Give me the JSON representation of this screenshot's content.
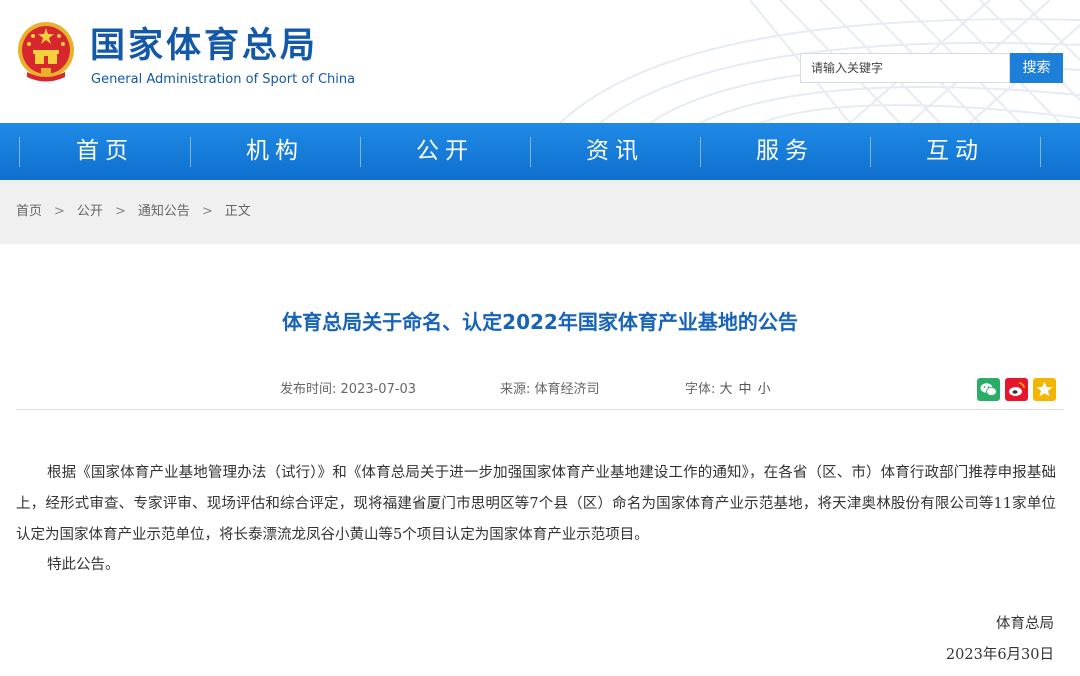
{
  "header": {
    "brand_cn": "国家体育总局",
    "brand_en": "General Administration of Sport of China",
    "search_placeholder": "请输入关键字",
    "search_button": "搜索"
  },
  "nav": {
    "items": [
      {
        "label": "首页"
      },
      {
        "label": "机构"
      },
      {
        "label": "公开"
      },
      {
        "label": "资讯"
      },
      {
        "label": "服务"
      },
      {
        "label": "互动"
      }
    ]
  },
  "breadcrumb": {
    "items": [
      "首页",
      "公开",
      "通知公告",
      "正文"
    ],
    "separator": ">"
  },
  "article": {
    "title": "体育总局关于命名、认定2022年国家体育产业基地的公告",
    "publish_label": "发布时间:",
    "publish_date": "2023-07-03",
    "source_label": "来源:",
    "source": "体育经济司",
    "font_label": "字体:",
    "font_sizes": [
      "大",
      "中",
      "小"
    ],
    "paragraphs": [
      "根据《国家体育产业基地管理办法（试行）》和《体育总局关于进一步加强国家体育产业基地建设工作的通知》，在各省（区、市）体育行政部门推荐申报基础上，经形式审查、专家评审、现场评估和综合评定，现将福建省厦门市思明区等7个县（区）命名为国家体育产业示范基地，将天津奥林股份有限公司等11家单位认定为国家体育产业示范单位，将长泰漂流龙凤谷小黄山等5个项目认定为国家体育产业示范项目。",
      "特此公告。"
    ],
    "signature": "体育总局",
    "sign_date": "2023年6月30日"
  },
  "share": {
    "icons": [
      "wechat-icon",
      "weibo-icon",
      "favorite-icon"
    ],
    "colors": {
      "wechat": "#2aae67",
      "weibo": "#e6162d",
      "favorite": "#f5b400"
    }
  },
  "colors": {
    "brand": "#1359a8",
    "nav": "#1478d8",
    "title": "#1763b8",
    "search_button": "#1e7fd8"
  }
}
